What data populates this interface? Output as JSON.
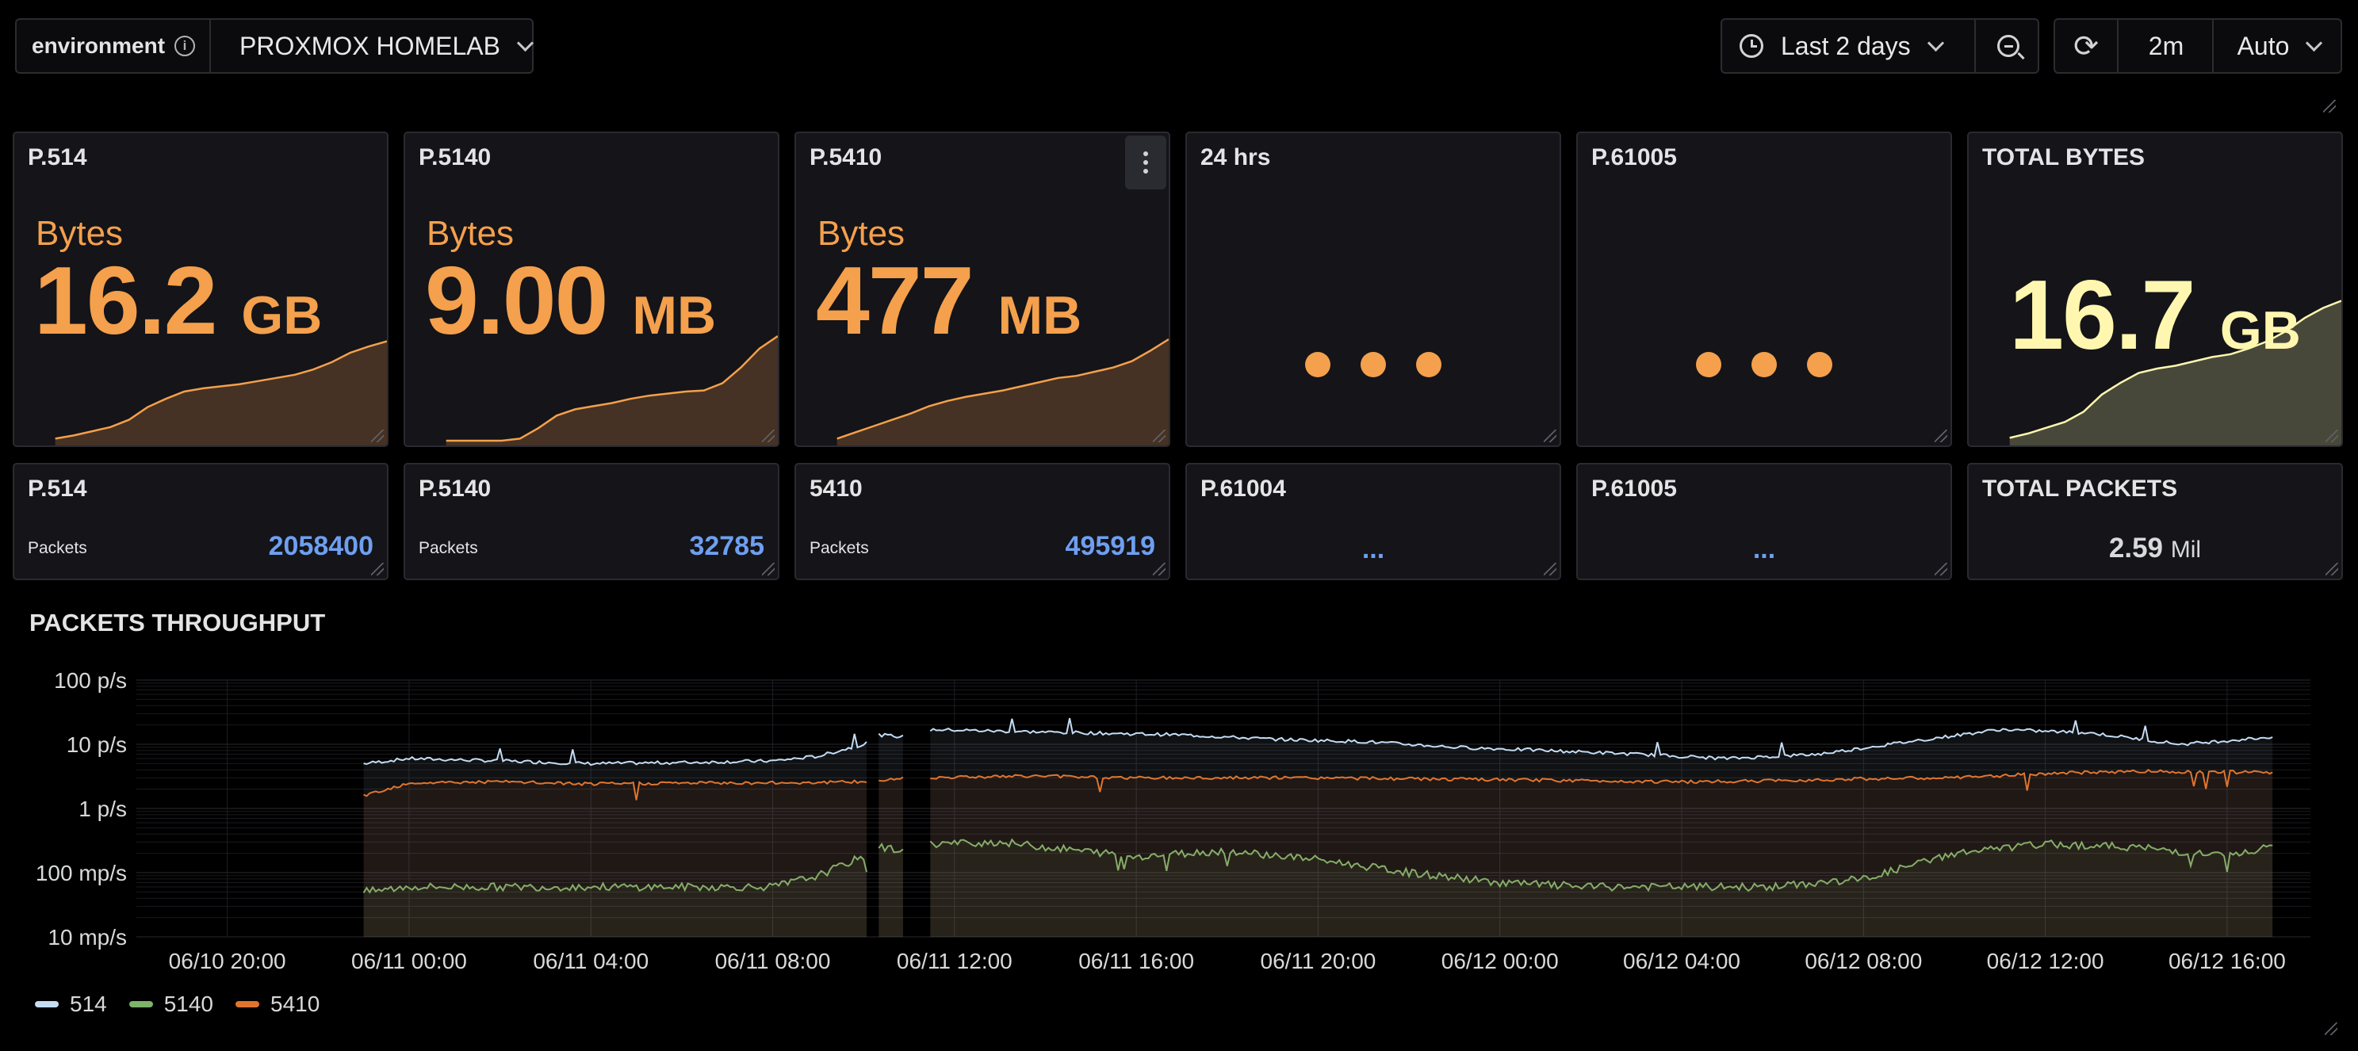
{
  "toolbar": {
    "variable_label": "environment",
    "variable_value": "PROXMOX HOMELAB",
    "time_range": "Last 2 days",
    "refresh_interval": "2m",
    "refresh_mode": "Auto"
  },
  "stat_panels": [
    {
      "title": "P.514",
      "prefix": "Bytes",
      "value": "16.2",
      "unit": "GB",
      "spark": [
        0.02,
        0.05,
        0.09,
        0.13,
        0.2,
        0.32,
        0.4,
        0.47,
        0.5,
        0.52,
        0.54,
        0.57,
        0.6,
        0.63,
        0.68,
        0.75,
        0.84,
        0.9,
        0.95
      ]
    },
    {
      "title": "P.5140",
      "prefix": "Bytes",
      "value": "9.00",
      "unit": "MB",
      "spark": [
        0.0,
        0.0,
        0.0,
        0.0,
        0.02,
        0.12,
        0.24,
        0.3,
        0.33,
        0.36,
        0.4,
        0.43,
        0.45,
        0.47,
        0.48,
        0.55,
        0.7,
        0.88,
        1.0
      ]
    },
    {
      "title": "P.5410",
      "prefix": "Bytes",
      "value": "477",
      "unit": "MB",
      "spark": [
        0.02,
        0.08,
        0.14,
        0.2,
        0.26,
        0.33,
        0.38,
        0.42,
        0.45,
        0.48,
        0.52,
        0.56,
        0.6,
        0.62,
        0.66,
        0.7,
        0.76,
        0.86,
        0.97
      ]
    },
    {
      "title": "24 hrs",
      "loading": true
    },
    {
      "title": "P.61005",
      "loading": true
    },
    {
      "title": "TOTAL BYTES",
      "value": "16.7",
      "unit": "GB",
      "spark": [
        0.02,
        0.05,
        0.09,
        0.13,
        0.2,
        0.32,
        0.4,
        0.47,
        0.5,
        0.52,
        0.55,
        0.58,
        0.6,
        0.64,
        0.69,
        0.76,
        0.85,
        0.92,
        0.97
      ]
    }
  ],
  "packet_panels": [
    {
      "title": "P.514",
      "label": "Packets",
      "value": "2058400"
    },
    {
      "title": "P.5140",
      "label": "Packets",
      "value": "32785"
    },
    {
      "title": "5410",
      "label": "Packets",
      "value": "495919"
    },
    {
      "title": "P.61004",
      "value": "..."
    },
    {
      "title": "P.61005",
      "value": "..."
    },
    {
      "title": "TOTAL PACKETS",
      "value": "2.59",
      "unit": "Mil"
    }
  ],
  "colors": {
    "accent_orange": "#f4a04c",
    "total_yellow": "#fff7b0",
    "value_blue": "#6e9ff0",
    "panel_bg": "#141419"
  },
  "chart_data": {
    "type": "line",
    "title": "PACKETS THROUGHPUT",
    "scale": "log10",
    "ylim": [
      0.01,
      100
    ],
    "y_ticks": [
      "100 p/s",
      "10 p/s",
      "1 p/s",
      "100 mp/s",
      "10 mp/s"
    ],
    "x_ticks": [
      "06/10 20:00",
      "06/11 00:00",
      "06/11 04:00",
      "06/11 08:00",
      "06/11 12:00",
      "06/11 16:00",
      "06/11 20:00",
      "06/12 00:00",
      "06/12 04:00",
      "06/12 08:00",
      "06/12 12:00",
      "06/12 16:00"
    ],
    "x_range": [
      "06/10 18:00",
      "06/12 17:50"
    ],
    "grid": true,
    "legend_position": "bottom-left",
    "gaps": [
      [
        "06/11 10:05",
        "06/11 10:20"
      ],
      [
        "06/11 10:55",
        "06/11 11:25"
      ]
    ],
    "series": [
      {
        "name": "514",
        "color": "#c4dcf4",
        "x": [
          "06/10 23:00",
          "06/11 00:00",
          "06/11 02:00",
          "06/11 04:00",
          "06/11 06:00",
          "06/11 08:00",
          "06/11 09:00",
          "06/11 10:00",
          "06/11 10:20",
          "06/11 10:55",
          "06/11 11:30",
          "06/11 13:00",
          "06/11 15:00",
          "06/11 17:00",
          "06/11 19:00",
          "06/11 21:00",
          "06/11 23:00",
          "06/12 01:00",
          "06/12 03:00",
          "06/12 05:00",
          "06/12 07:00",
          "06/12 09:00",
          "06/12 11:00",
          "06/12 13:00",
          "06/12 15:00",
          "06/12 17:00"
        ],
        "y": [
          5,
          6,
          5.5,
          5,
          5.2,
          5.5,
          6.5,
          10,
          14,
          13,
          17,
          16,
          15,
          14,
          12,
          11,
          9,
          8,
          7,
          6,
          7,
          11,
          17,
          15,
          10,
          13
        ]
      },
      {
        "name": "5140",
        "color": "#7eb26d",
        "x": [
          "06/10 23:00",
          "06/11 00:00",
          "06/11 02:00",
          "06/11 04:00",
          "06/11 06:00",
          "06/11 08:00",
          "06/11 09:00",
          "06/11 10:00",
          "06/11 10:20",
          "06/11 10:55",
          "06/11 11:30",
          "06/11 13:00",
          "06/11 14:00",
          "06/11 16:00",
          "06/11 18:00",
          "06/11 20:00",
          "06/11 22:00",
          "06/12 00:00",
          "06/12 02:00",
          "06/12 04:00",
          "06/12 06:00",
          "06/12 08:00",
          "06/12 10:00",
          "06/12 12:00",
          "06/12 14:00",
          "06/12 16:00",
          "06/12 17:00"
        ],
        "y": [
          0.05,
          0.06,
          0.06,
          0.06,
          0.06,
          0.06,
          0.09,
          0.18,
          0.25,
          0.22,
          0.28,
          0.3,
          0.25,
          0.18,
          0.22,
          0.16,
          0.1,
          0.07,
          0.06,
          0.06,
          0.06,
          0.08,
          0.2,
          0.28,
          0.25,
          0.18,
          0.25
        ]
      },
      {
        "name": "5410",
        "color": "#e0752d",
        "x": [
          "06/10 23:00",
          "06/11 00:00",
          "06/11 02:00",
          "06/11 04:00",
          "06/11 06:00",
          "06/11 08:00",
          "06/11 10:00",
          "06/11 10:20",
          "06/11 10:55",
          "06/11 12:00",
          "06/11 14:00",
          "06/11 16:00",
          "06/11 18:00",
          "06/11 20:00",
          "06/11 22:00",
          "06/12 00:00",
          "06/12 02:00",
          "06/12 04:00",
          "06/12 06:00",
          "06/12 08:00",
          "06/12 10:00",
          "06/12 12:00",
          "06/12 14:00",
          "06/12 16:00",
          "06/12 17:00"
        ],
        "y": [
          1.6,
          2.5,
          2.6,
          2.4,
          2.5,
          2.5,
          2.6,
          2.7,
          3,
          3.1,
          3.2,
          3,
          3,
          3,
          2.9,
          2.8,
          2.7,
          2.6,
          2.7,
          2.9,
          3,
          3.5,
          3.8,
          3.7,
          3.6
        ]
      }
    ]
  }
}
